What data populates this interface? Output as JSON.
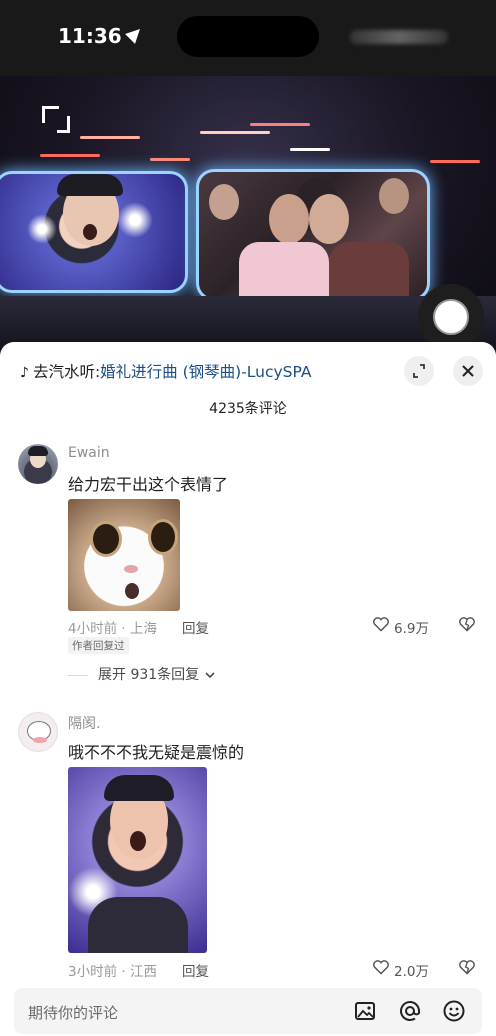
{
  "status": {
    "time": "11:36"
  },
  "music": {
    "prefix": "去汽水听:",
    "song": "婚礼进行曲 (钢琴曲)-LucySPA"
  },
  "comments_count": "4235条评论",
  "comments": [
    {
      "user": "Ewain",
      "text": "给力宏干出这个表情了",
      "meta": "4小时前 · 上海",
      "reply_label": "回复",
      "likes": "6.9万",
      "tag": "作者回复过",
      "expand": "展开 931条回复"
    },
    {
      "user": "隔阂.",
      "text": "哦不不不我无疑是震惊的",
      "meta": "3小时前 · 江西",
      "reply_label": "回复",
      "likes": "2.0万"
    }
  ],
  "input": {
    "placeholder": "期待你的评论"
  },
  "icons": {
    "location": "location-arrow-icon",
    "music": "music-note-icon",
    "expand": "expand-icon",
    "close": "close-icon",
    "heart": "heart-icon",
    "dislike": "broken-heart-icon",
    "chevron": "chevron-down-icon",
    "image": "image-icon",
    "mention": "at-icon",
    "emoji": "emoji-icon"
  }
}
